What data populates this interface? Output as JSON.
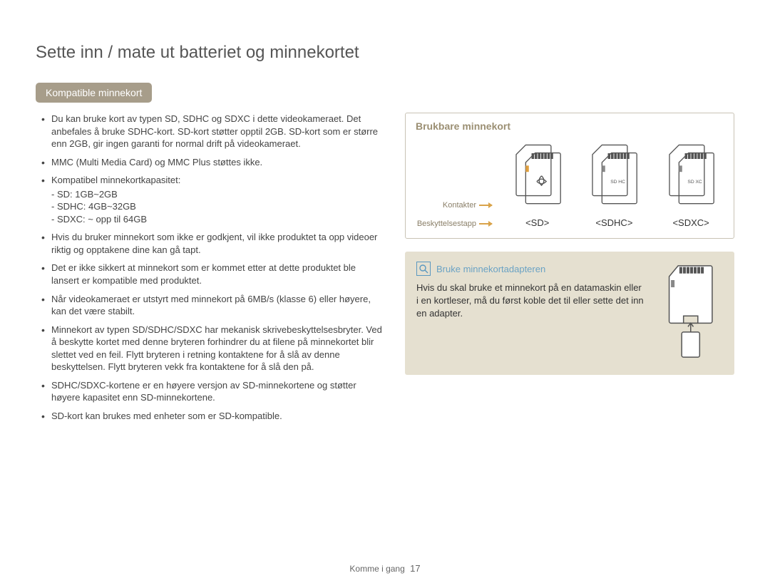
{
  "page_title": "Sette inn / mate ut batteriet og minnekortet",
  "section_heading": "Kompatible minnekort",
  "bullets": [
    {
      "text": "Du kan bruke kort av typen SD, SDHC og SDXC i dette videokameraet. Det anbefales å bruke SDHC-kort. SD-kort støtter opptil 2GB. SD-kort som er større enn 2GB, gir ingen garanti for normal drift på videokameraet."
    },
    {
      "text": "MMC (Multi Media Card) og MMC Plus støttes ikke."
    },
    {
      "text": "Kompatibel minnekortkapasitet:",
      "sub": [
        "- SD: 1GB~2GB",
        "- SDHC: 4GB~32GB",
        "- SDXC: ~ opp til 64GB"
      ]
    },
    {
      "text": "Hvis du bruker minnekort som ikke er godkjent, vil ikke produktet ta opp videoer riktig og opptakene dine kan gå tapt."
    },
    {
      "text": "Det er ikke sikkert at minnekort som er kommet etter at dette produktet ble lansert er kompatible med produktet."
    },
    {
      "text": "Når videokameraet er utstyrt med minnekort på 6MB/s (klasse 6) eller høyere, kan det være stabilt."
    },
    {
      "text": "Minnekort av typen SD/SDHC/SDXC har mekanisk skrivebeskyttelsesbryter. Ved å beskytte kortet med denne bryteren forhindrer du at filene på minnekortet blir slettet ved en feil. Flytt bryteren i retning kontaktene for å slå av denne beskyttelsen. Flytt bryteren vekk fra kontaktene for å slå den på."
    },
    {
      "text": "SDHC/SDXC-kortene er en høyere versjon av SD-minnekortene og støtter høyere kapasitet enn SD-minnekortene."
    },
    {
      "text": "SD-kort kan brukes med enheter som er SD-kompatible."
    }
  ],
  "usable_cards": {
    "heading": "Brukbare minnekort",
    "annotations": {
      "contacts": "Kontakter",
      "protect_tab": "Beskyttelsestapp"
    },
    "labels": {
      "sd": "<SD>",
      "sdhc": "<SDHC>",
      "sdxc": "<SDXC>"
    }
  },
  "adapter": {
    "title": "Bruke minnekortadapteren",
    "body": "Hvis du skal bruke et minnekort på en datamaskin eller i en kortleser, må du først koble det til eller sette det inn en adapter."
  },
  "footer": {
    "section": "Komme i gang",
    "page": "17"
  }
}
